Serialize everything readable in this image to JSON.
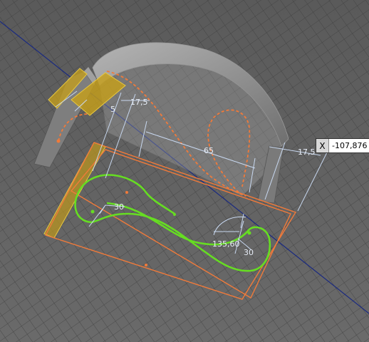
{
  "viewport": {
    "name": "CAD 3D sketch viewport"
  },
  "dimensions": {
    "d_17_5_left": "17,5",
    "d_5": "5",
    "d_65": "65",
    "d_17_5_right": "17,5",
    "d_30_left": "30",
    "d_135": "135,60",
    "d_30_right": "30"
  },
  "coordinate_input": {
    "label": "X",
    "value": "-107,876 n"
  },
  "colors": {
    "background": "#5c5c5c",
    "grid": "#3a3a3a",
    "sketch_orange": "#f07a3a",
    "profile_green": "#66dd22",
    "dimension_blue": "#c8d8f0",
    "selection_yellow": "#c8a018",
    "axis_blue": "#1a2a80"
  }
}
